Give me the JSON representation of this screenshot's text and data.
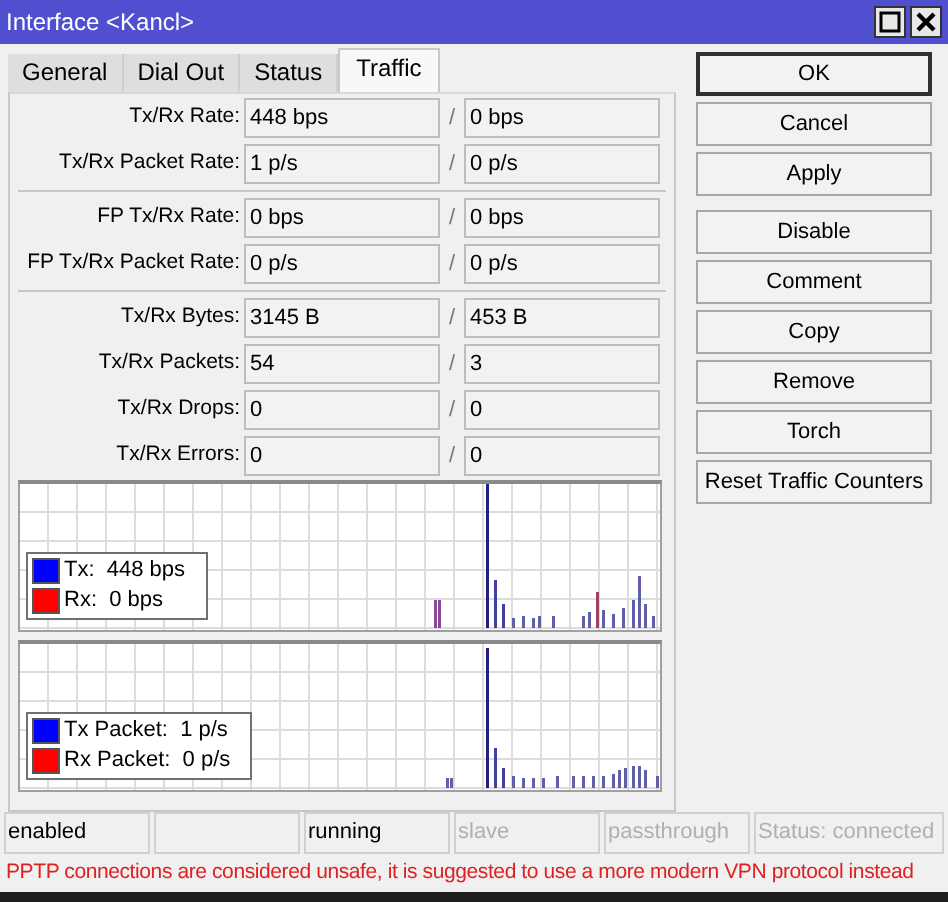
{
  "window": {
    "title": "Interface <Kancl>"
  },
  "tabs": [
    {
      "label": "General",
      "selected": false
    },
    {
      "label": "Dial Out",
      "selected": false
    },
    {
      "label": "Status",
      "selected": false
    },
    {
      "label": "Traffic",
      "selected": true
    }
  ],
  "field_groups": [
    [
      {
        "label": "Tx/Rx Rate:",
        "tx": "448 bps",
        "rx": "0 bps"
      },
      {
        "label": "Tx/Rx Packet Rate:",
        "tx": "1 p/s",
        "rx": "0 p/s"
      }
    ],
    [
      {
        "label": "FP Tx/Rx Rate:",
        "tx": "0 bps",
        "rx": "0 bps"
      },
      {
        "label": "FP Tx/Rx Packet Rate:",
        "tx": "0 p/s",
        "rx": "0 p/s"
      }
    ],
    [
      {
        "label": "Tx/Rx Bytes:",
        "tx": "3145 B",
        "rx": "453 B"
      },
      {
        "label": "Tx/Rx Packets:",
        "tx": "54",
        "rx": "3"
      },
      {
        "label": "Tx/Rx Drops:",
        "tx": "0",
        "rx": "0"
      },
      {
        "label": "Tx/Rx Errors:",
        "tx": "0",
        "rx": "0"
      }
    ]
  ],
  "separator": "/",
  "graphs": [
    {
      "legend": [
        {
          "text": "Tx:  448 bps",
          "color": "#0000ff"
        },
        {
          "text": "Rx:  0 bps",
          "color": "#ff0000"
        }
      ]
    },
    {
      "legend": [
        {
          "text": "Tx Packet:  1 p/s",
          "color": "#0000ff"
        },
        {
          "text": "Rx Packet:  0 p/s",
          "color": "#ff0000"
        }
      ]
    }
  ],
  "button_groups": [
    [
      {
        "label": "OK",
        "default": true
      },
      {
        "label": "Cancel",
        "default": false
      },
      {
        "label": "Apply",
        "default": false
      }
    ],
    [
      {
        "label": "Disable",
        "default": false
      },
      {
        "label": "Comment",
        "default": false
      },
      {
        "label": "Copy",
        "default": false
      },
      {
        "label": "Remove",
        "default": false
      },
      {
        "label": "Torch",
        "default": false
      },
      {
        "label": "Reset Traffic Counters",
        "default": false
      }
    ]
  ],
  "status_bar": [
    {
      "kind": "text",
      "text": "enabled",
      "disabled": false
    },
    {
      "kind": "blank"
    },
    {
      "kind": "text",
      "text": "running",
      "disabled": false
    },
    {
      "kind": "text",
      "text": "slave",
      "disabled": true
    },
    {
      "kind": "text",
      "text": "passthrough",
      "disabled": true
    },
    {
      "kind": "text",
      "text": "Status: connected",
      "disabled": true
    }
  ],
  "warning": "PPTP connections are considered unsafe, it is suggested to use a more modern VPN protocol instead"
}
